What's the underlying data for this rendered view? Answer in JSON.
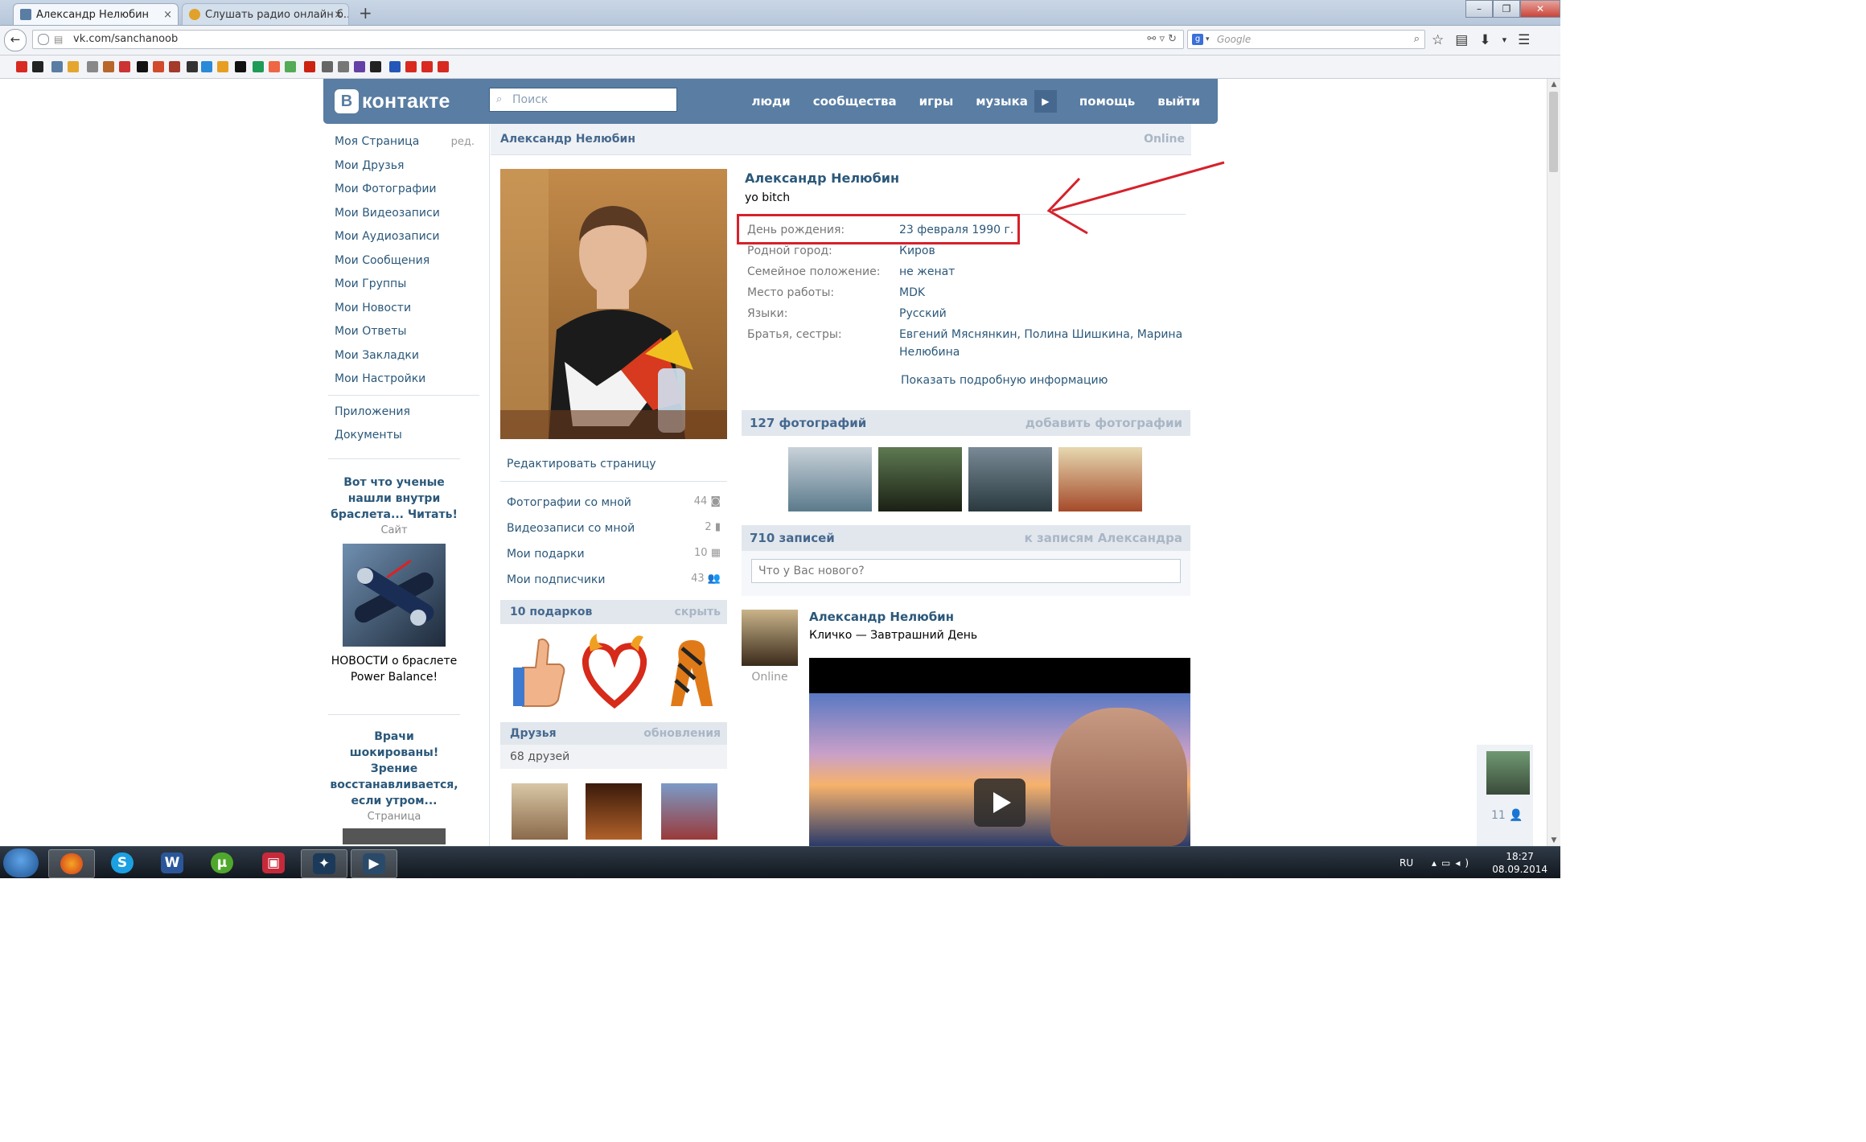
{
  "browser": {
    "tabs": [
      {
        "label": "Александр Нелюбин",
        "close": "×"
      },
      {
        "label": "Слушать радио онлайн б...",
        "close": "×"
      }
    ],
    "new_tab": "+",
    "url": "vk.com/sanchanoob",
    "search_placeholder": "Google"
  },
  "vk": {
    "logo_letter": "В",
    "logo_text": "контакте",
    "search_placeholder": "Поиск",
    "nav": [
      "люди",
      "сообщества",
      "игры",
      "музыка",
      "помощь",
      "выйти"
    ]
  },
  "left_menu": {
    "items": [
      "Моя Страница",
      "Мои Друзья",
      "Мои Фотографии",
      "Мои Видеозаписи",
      "Мои Аудиозаписи",
      "Мои Сообщения",
      "Мои Группы",
      "Мои Новости",
      "Мои Ответы",
      "Мои Закладки",
      "Мои Настройки"
    ],
    "edit": "ред.",
    "extra": [
      "Приложения",
      "Документы"
    ]
  },
  "ads": [
    {
      "title": "Вот что ученые нашли внутри браслета... Читать!",
      "source": "Сайт",
      "text": "НОВОСТИ о браслете Power Balance!"
    },
    {
      "title": "Врачи шокированы! Зрение восстанавливается, если утром...",
      "source": "Страница"
    }
  ],
  "profile": {
    "header_name": "Александр Нелюбин",
    "header_status": "Online",
    "name": "Александр Нелюбин",
    "status": "yo bitch",
    "fields": [
      {
        "label": "День рождения:",
        "value": "23 февраля 1990 г."
      },
      {
        "label": "Родной город:",
        "value": "Киров"
      },
      {
        "label": "Семейное положение:",
        "value": "не женат"
      },
      {
        "label": "Место работы:",
        "value": "MDK"
      },
      {
        "label": "Языки:",
        "value": "Русский"
      },
      {
        "label": "Братья, сестры:",
        "value": "Евгений Мяснянкин, Полина Шишкина, Марина Нелюбина"
      }
    ],
    "more_info": "Показать подробную информацию",
    "edit_page": "Редактировать страницу",
    "links": [
      {
        "label": "Фотографии со мной",
        "count": "44"
      },
      {
        "label": "Видеозаписи со мной",
        "count": "2"
      },
      {
        "label": "Мои подарки",
        "count": "10"
      },
      {
        "label": "Мои подписчики",
        "count": "43"
      }
    ],
    "gifts_header": "10 подарков",
    "gifts_hide": "скрыть",
    "friends_header": "Друзья",
    "friends_updates": "обновления",
    "friends_count": "68 друзей"
  },
  "photos": {
    "header": "127 фотографий",
    "add": "добавить фотографии"
  },
  "wall": {
    "header": "710 записей",
    "link": "к записям Александра",
    "input_placeholder": "Что у Вас нового?",
    "post": {
      "author": "Александр Нелюбин",
      "text": "Кличко — Завтрашний День",
      "online": "Online"
    }
  },
  "sidechat": {
    "count": "11"
  },
  "taskbar": {
    "lang": "RU",
    "time": "18:27",
    "date": "08.09.2014"
  },
  "colors": {
    "vk_header": "#597da3",
    "link": "#2b587a",
    "highlight": "#d6212b"
  }
}
